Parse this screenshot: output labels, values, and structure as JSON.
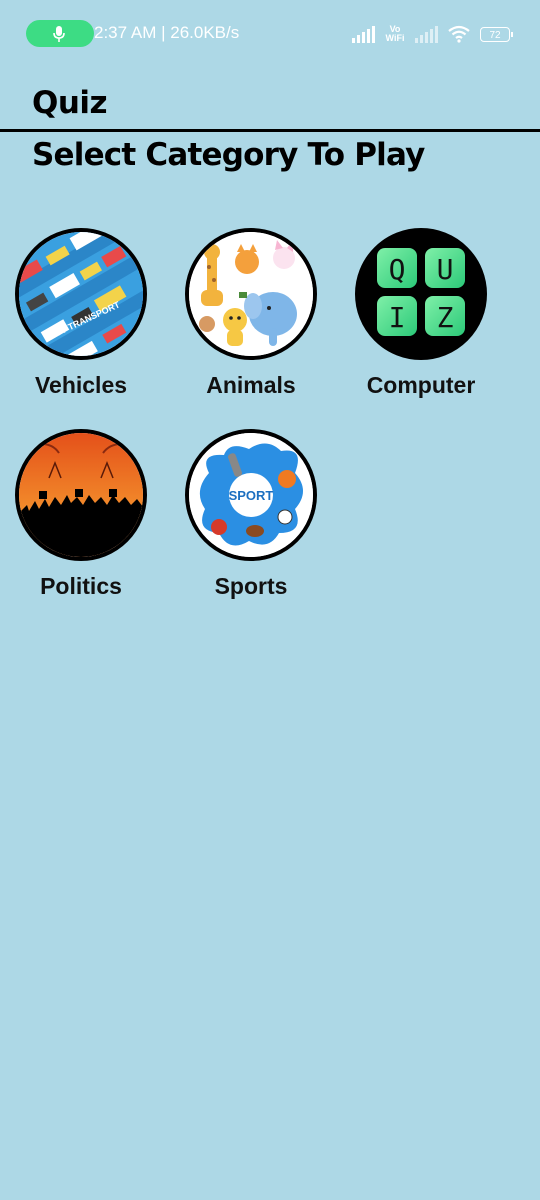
{
  "status": {
    "time_speed": "2:37 AM | 26.0KB/s",
    "vowifi": "Vo WiFi",
    "battery": "72",
    "mic_color": "#3ddc84"
  },
  "header": {
    "title": "Quiz",
    "subtitle": "Select Category To Play"
  },
  "categories": [
    {
      "label": "Vehicles",
      "image": "vehicles-image"
    },
    {
      "label": "Animals",
      "image": "animals-image"
    },
    {
      "label": "Computer",
      "image": "quiz-tiles-image"
    },
    {
      "label": "Politics",
      "image": "politics-image"
    },
    {
      "label": "Sports",
      "image": "sports-image"
    }
  ],
  "images": {
    "quiz_letters": [
      "Q",
      "U",
      "I",
      "Z"
    ],
    "vehicles_text": "CITY TRANSPORT",
    "sports_text": "SPORT"
  },
  "colors": {
    "background": "#add8e6",
    "text": "#000000"
  }
}
